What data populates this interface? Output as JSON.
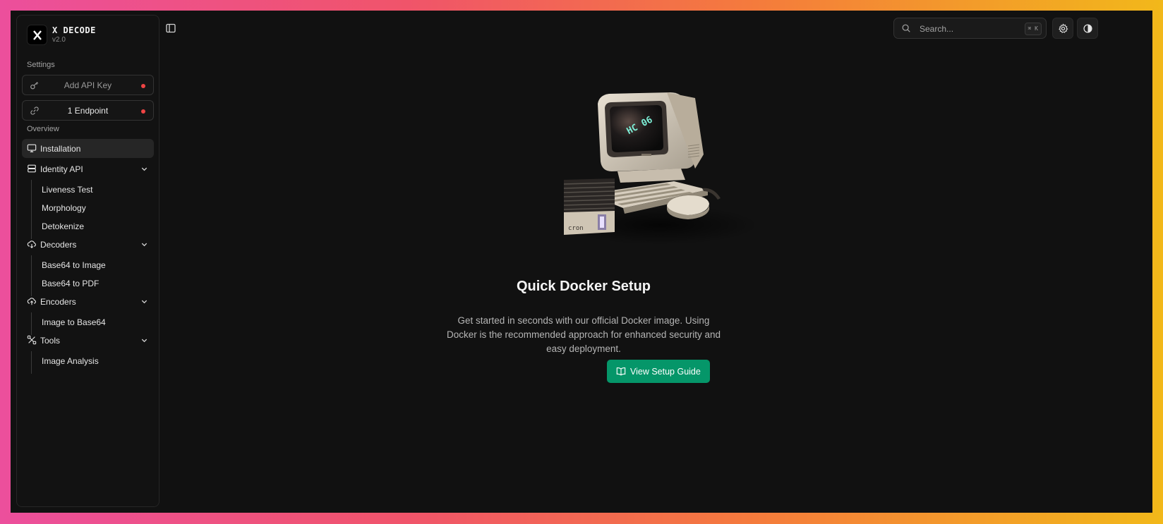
{
  "brand": {
    "name": "X DECODE",
    "version": "v2.0"
  },
  "sidebar": {
    "settings_label": "Settings",
    "api_key_button": "Add API Key",
    "endpoint_button": "1 Endpoint",
    "overview_label": "Overview",
    "items": [
      {
        "label": "Installation",
        "icon": "monitor-icon",
        "active": true
      },
      {
        "label": "Identity API",
        "icon": "server-icon",
        "children": [
          "Liveness Test",
          "Morphology",
          "Detokenize"
        ]
      },
      {
        "label": "Decoders",
        "icon": "cloud-download-icon",
        "children": [
          "Base64 to Image",
          "Base64 to PDF"
        ]
      },
      {
        "label": "Encoders",
        "icon": "cloud-upload-icon",
        "children": [
          "Image to Base64"
        ]
      },
      {
        "label": "Tools",
        "icon": "tools-icon",
        "children": [
          "Image Analysis"
        ]
      }
    ]
  },
  "header": {
    "search_placeholder": "Search...",
    "search_shortcut": "⌘ K"
  },
  "main": {
    "hero_screen_text": "HC 06",
    "hero_drive_label": "cron",
    "title": "Quick Docker Setup",
    "description": "Get started in seconds with our official Docker image. Using Docker is the recommended approach for enhanced security and easy deployment.",
    "cta_label": "View Setup Guide"
  },
  "colors": {
    "accent": "#059669",
    "status_dot": "#ef4444",
    "background": "#111111"
  }
}
